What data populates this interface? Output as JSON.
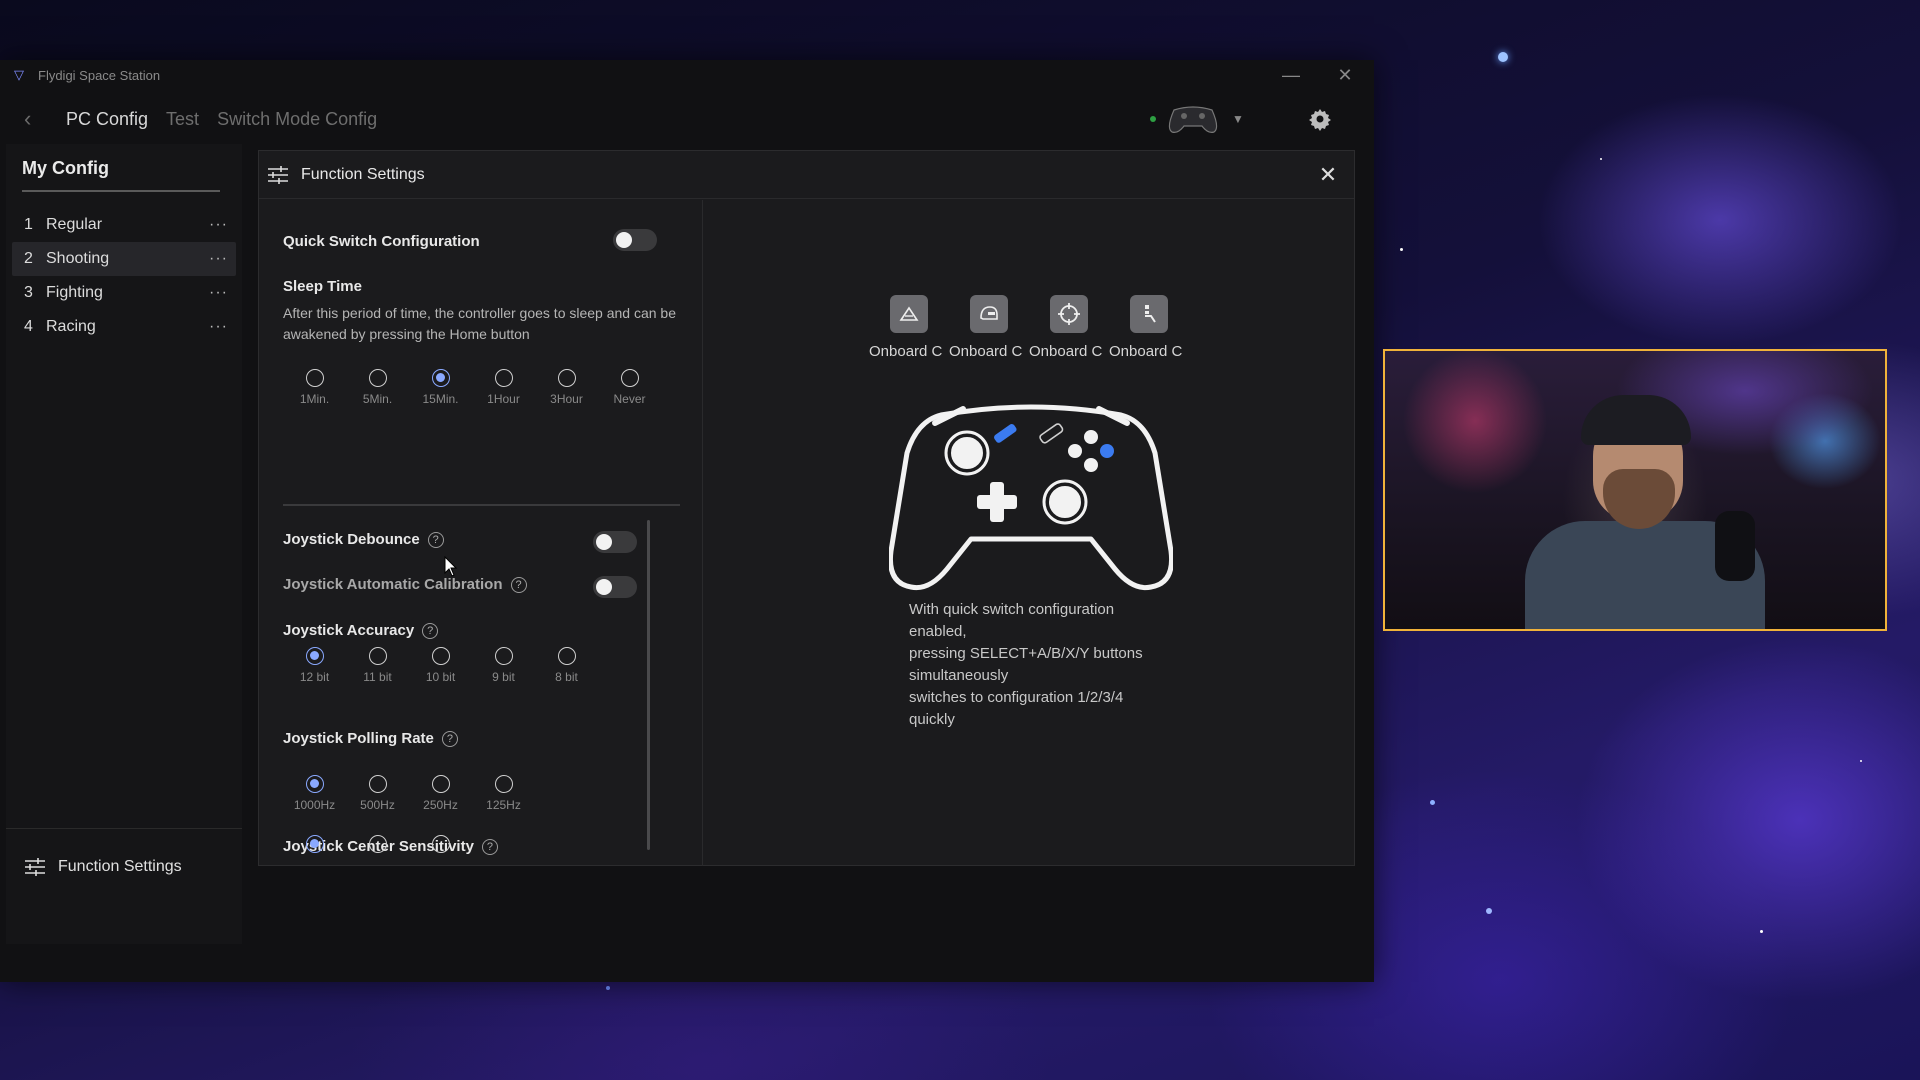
{
  "window": {
    "title": "Flydigi Space Station"
  },
  "nav": {
    "tabs": [
      "PC Config",
      "Test",
      "Switch Mode Config"
    ]
  },
  "sidebar": {
    "title": "My Config",
    "items": [
      {
        "num": "1",
        "label": "Regular"
      },
      {
        "num": "2",
        "label": "Shooting"
      },
      {
        "num": "3",
        "label": "Fighting"
      },
      {
        "num": "4",
        "label": "Racing"
      }
    ],
    "more": "···",
    "footer_label": "Function Settings"
  },
  "panel": {
    "title": "Function Settings",
    "quick_switch": {
      "label": "Quick Switch Configuration",
      "enabled": false
    },
    "sleep_time": {
      "label": "Sleep Time",
      "description": "After this period of time, the controller goes to sleep and can be awakened by pressing the Home button",
      "options": [
        "1Min.",
        "5Min.",
        "15Min.",
        "1Hour",
        "3Hour",
        "Never"
      ],
      "selected": "15Min."
    },
    "joystick_debounce": {
      "label": "Joystick Debounce",
      "help": "?",
      "enabled": false
    },
    "joystick_calibration": {
      "label": "Joystick Automatic Calibration",
      "help": "?",
      "enabled": false
    },
    "joystick_accuracy": {
      "label": "Joystick Accuracy",
      "help": "?",
      "options": [
        "12 bit",
        "11 bit",
        "10 bit",
        "9 bit",
        "8 bit"
      ],
      "selected": "12 bit"
    },
    "joystick_polling": {
      "label": "Joystick Polling Rate",
      "help": "?",
      "options": [
        "1000Hz",
        "500Hz",
        "250Hz",
        "125Hz"
      ],
      "selected": "1000Hz"
    },
    "joystick_center": {
      "label": "Joystick Center Sensitivity",
      "help": "?",
      "options": [
        "",
        "",
        ""
      ],
      "selected_index": 0
    },
    "modes": [
      {
        "label": "Onboard C",
        "icon": "regular-mode-icon"
      },
      {
        "label": "Onboard C",
        "icon": "racing-helmet-icon"
      },
      {
        "label": "Onboard C",
        "icon": "crosshair-icon"
      },
      {
        "label": "Onboard C",
        "icon": "fighting-icon"
      }
    ],
    "info_lines": [
      "With quick switch configuration",
      "enabled,",
      "pressing SELECT+A/B/X/Y buttons",
      "simultaneously",
      "switches to configuration 1/2/3/4",
      "quickly"
    ]
  },
  "colors": {
    "accent": "#8aa9ff",
    "select_button": "#3b7bf0",
    "webcam_border": "#f0b23a"
  }
}
